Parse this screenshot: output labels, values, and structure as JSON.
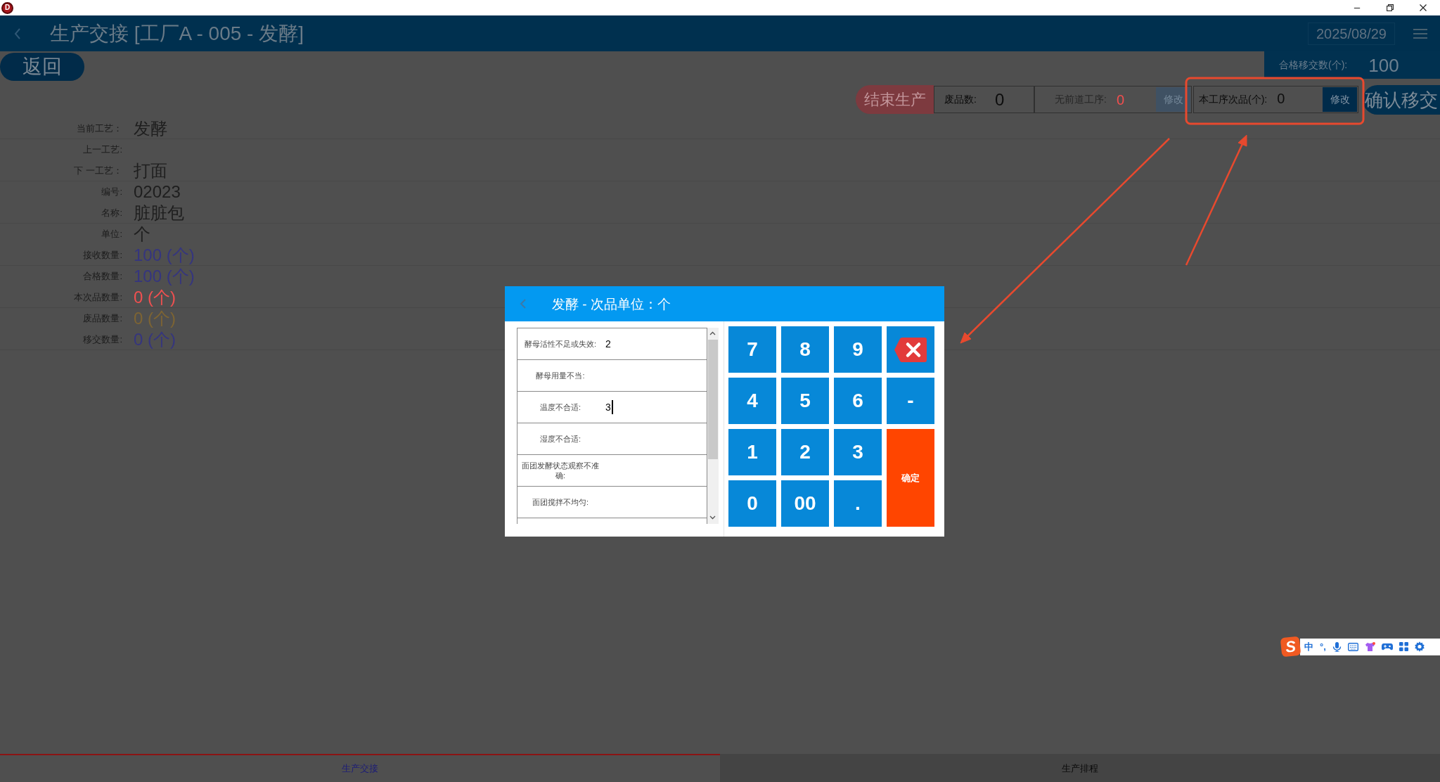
{
  "window": {
    "logo": "D"
  },
  "header": {
    "title": "生产交接 [工厂A - 005 - 发酵]",
    "date": "2025/08/29"
  },
  "back_button": {
    "label": "返回"
  },
  "qualified_transfer": {
    "label": "合格移交数(个):",
    "value": "100"
  },
  "toolbar": [
    {
      "kind": "end",
      "label": "结束生产"
    },
    {
      "kind": "count",
      "label": "废品数:",
      "value": "0",
      "color": "#0d0d0d",
      "disabled": false
    },
    {
      "kind": "count",
      "label": "无前道工序:",
      "value": "0",
      "color": "#f24e4e",
      "disabled": true,
      "edit": "修改"
    },
    {
      "kind": "count",
      "label": "本工序次品(个):",
      "value": "0",
      "color": "#0d0d0d",
      "disabled": false,
      "edit": "修改"
    },
    {
      "kind": "confirm",
      "label": "确认移交"
    }
  ],
  "info": [
    {
      "label": "当前工艺：",
      "value": "发酵",
      "color": "#1e1e1e"
    },
    {
      "label": "上一工艺:"
    },
    {
      "label": "下 一工艺：",
      "value": "打面",
      "color": "#1e1e1e"
    },
    {
      "label": "编号:",
      "value": "02023",
      "color": "#1e1e1e"
    },
    {
      "label": "名称:",
      "value": "脏脏包",
      "color": "#1e1e1e"
    },
    {
      "label": "单位:",
      "value": "个",
      "color": "#1e1e1e"
    },
    {
      "label": "接收数量:",
      "value": "100 (个)",
      "color": "#35357f"
    },
    {
      "label": "合格数量:",
      "value": "100 (个)",
      "color": "#35357f"
    },
    {
      "label": "本次品数量:",
      "value": "0 (个)",
      "color": "#f05050"
    },
    {
      "label": "废品数量:",
      "value": "0 (个)",
      "color": "#7d6433"
    },
    {
      "label": "移交数量:",
      "value": "0 (个)",
      "color": "#35357f"
    }
  ],
  "dialog": {
    "title": "发酵 - 次品单位：个",
    "rows": [
      {
        "label": "酵母活性不足或失效:",
        "value": "2",
        "focused": false
      },
      {
        "label": "酵母用量不当:",
        "focused": false
      },
      {
        "label": "温度不合适:",
        "value": "3",
        "focused": true
      },
      {
        "label": "湿度不合适:",
        "focused": false
      },
      {
        "label": "面团发酵状态观察不准确:",
        "focused": false
      },
      {
        "label": "面团搅拌不均匀:",
        "focused": false
      }
    ],
    "keys": [
      {
        "kind": "digit",
        "label": "7"
      },
      {
        "kind": "digit",
        "label": "8"
      },
      {
        "kind": "digit",
        "label": "9"
      },
      {
        "kind": "backspace"
      },
      {
        "kind": "digit",
        "label": "4"
      },
      {
        "kind": "digit",
        "label": "5"
      },
      {
        "kind": "digit",
        "label": "6"
      },
      {
        "kind": "digit",
        "label": "-"
      },
      {
        "kind": "digit",
        "label": "1"
      },
      {
        "kind": "digit",
        "label": "2"
      },
      {
        "kind": "digit",
        "label": "3"
      },
      {
        "kind": "confirm",
        "label": "确定"
      },
      {
        "kind": "digit",
        "label": "0"
      },
      {
        "kind": "digit",
        "label": "00"
      },
      {
        "kind": "digit",
        "label": "."
      }
    ]
  },
  "bottom_tabs": [
    {
      "label": "生产交接",
      "selected": true
    },
    {
      "label": "生产排程",
      "selected": false
    }
  ],
  "ime_toolbar": {
    "logo": "S",
    "mode": "中",
    "punctuation": "°,"
  }
}
